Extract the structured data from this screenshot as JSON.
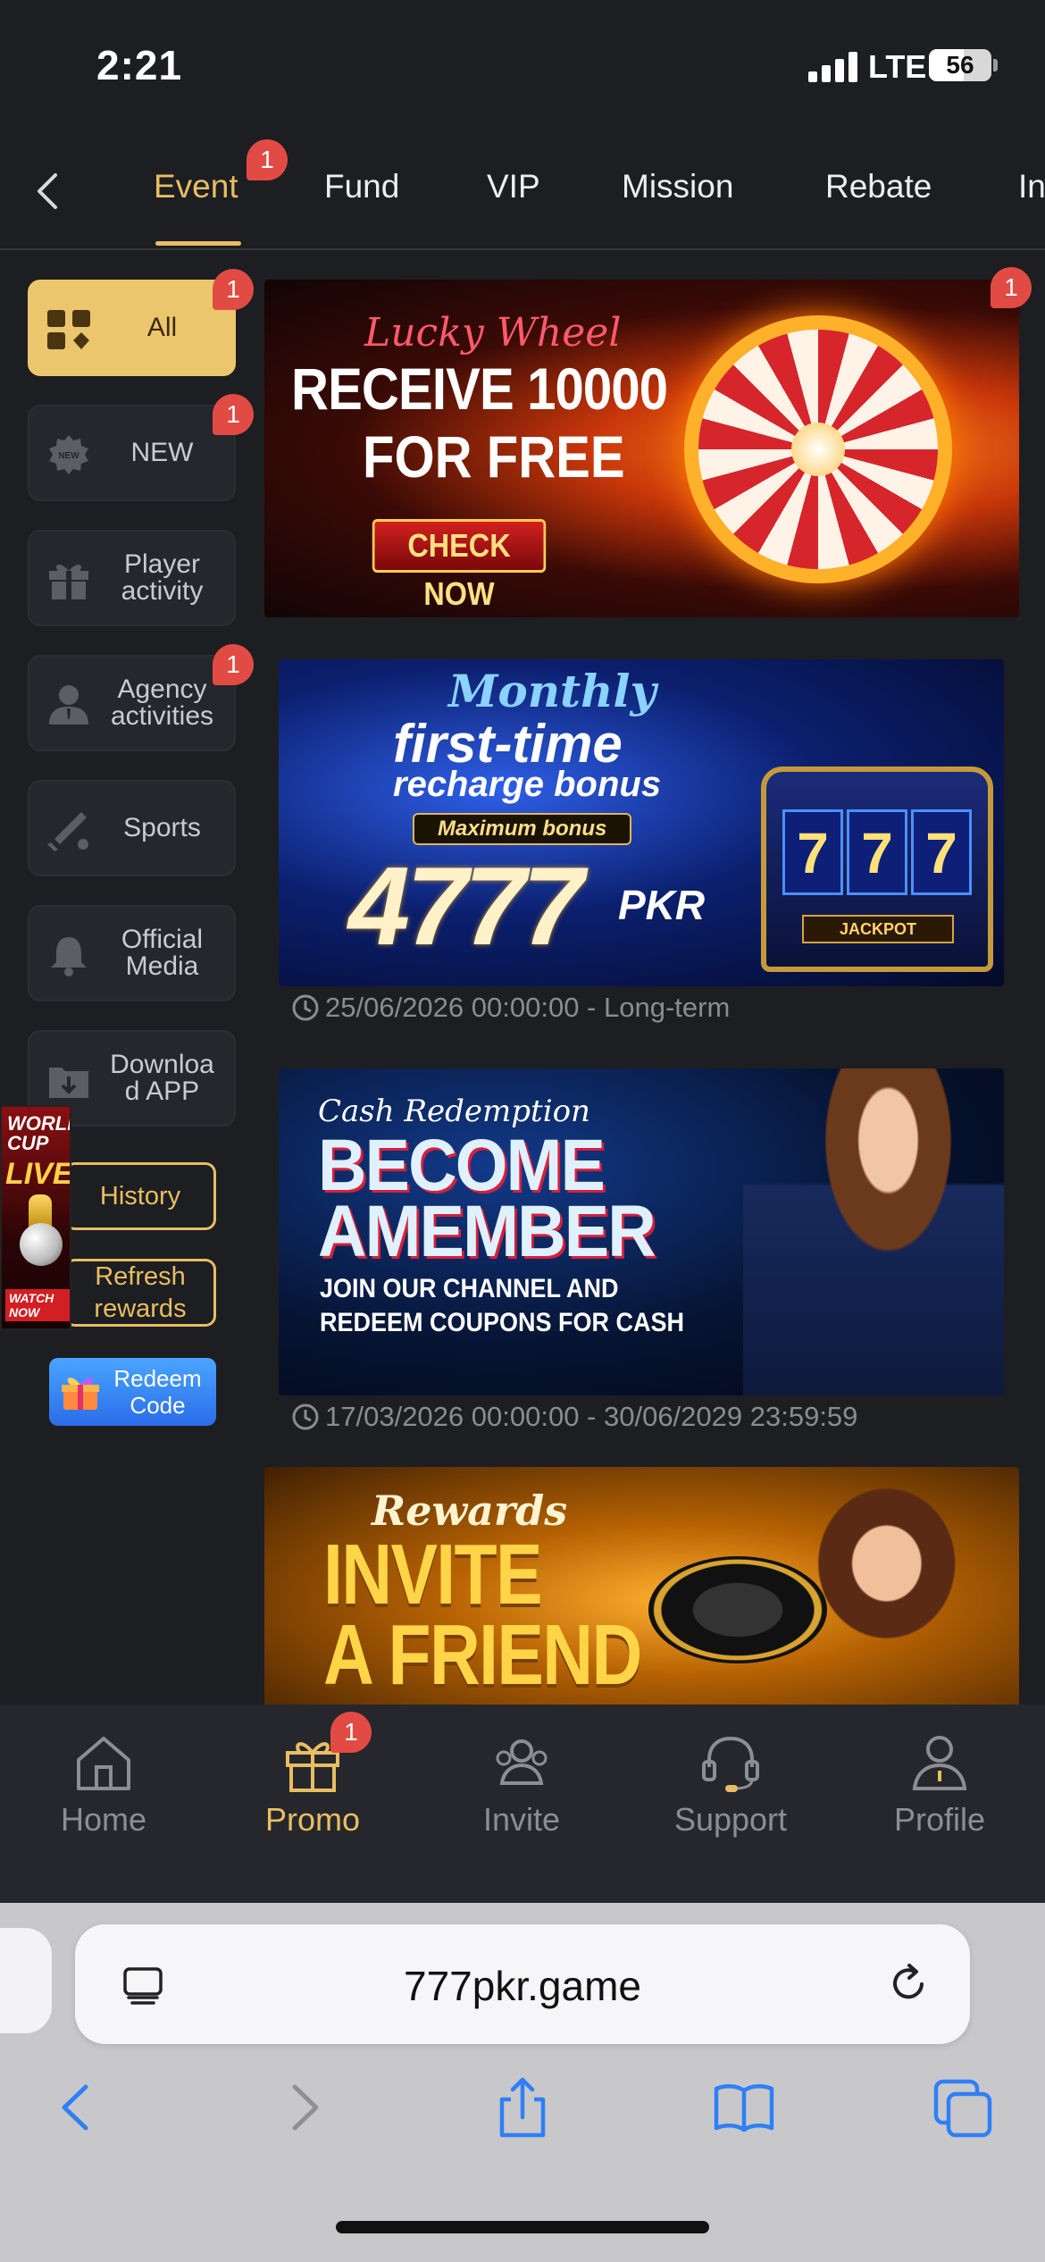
{
  "status_bar": {
    "time": "2:21",
    "network": "LTE",
    "battery": "56"
  },
  "tabs": [
    {
      "label": "Event",
      "active": true,
      "badge": "1"
    },
    {
      "label": "Fund"
    },
    {
      "label": "VIP"
    },
    {
      "label": "Mission"
    },
    {
      "label": "Rebate"
    },
    {
      "label": "In"
    }
  ],
  "sidebar": {
    "items": [
      {
        "label": "All",
        "active": true,
        "badge": "1",
        "icon": "grid-icon"
      },
      {
        "label": "NEW",
        "badge": "1",
        "icon": "new-badge-icon"
      },
      {
        "label": "Player activity",
        "icon": "gift-icon"
      },
      {
        "label": "Agency activities",
        "badge": "1",
        "icon": "agent-icon"
      },
      {
        "label": "Sports",
        "icon": "sports-icon"
      },
      {
        "label": "Official Media",
        "icon": "bell-icon"
      },
      {
        "label": "Download APP",
        "icon": "download-icon"
      }
    ],
    "history": "History",
    "refresh_rewards": "Refresh rewards",
    "redeem_code": "Redeem Code",
    "worldcup_ad": {
      "line1": "WORLD CUP",
      "line2": "LIVE",
      "cta": "WATCH NOW"
    }
  },
  "banners": [
    {
      "badge": "1",
      "script": "Lucky Wheel",
      "line1": "RECEIVE 10000",
      "line2": "FOR FREE",
      "cta": "CHECK NOW"
    },
    {
      "script": "Monthly",
      "line1": "first-time",
      "line2": "recharge bonus",
      "tag": "Maximum bonus",
      "amount": "4777",
      "currency": "PKR",
      "slot_text": "777",
      "jackpot": "JACKPOT",
      "date": "25/06/2026 00:00:00 - Long-term"
    },
    {
      "script": "Cash Redemption",
      "line1": "BECOME",
      "line2": "AMEMBER",
      "sub1": "JOIN OUR CHANNEL AND",
      "sub2": "REDEEM COUPONS FOR CASH",
      "date": "17/03/2026 00:00:00 - 30/06/2029 23:59:59"
    },
    {
      "script": "Rewards",
      "line1": "INVITE",
      "line2": "A FRIEND"
    }
  ],
  "bottom_nav": [
    {
      "label": "Home",
      "icon": "home-icon"
    },
    {
      "label": "Promo",
      "icon": "gift-icon",
      "active": true,
      "badge": "1"
    },
    {
      "label": "Invite",
      "icon": "invite-icon"
    },
    {
      "label": "Support",
      "icon": "headset-icon"
    },
    {
      "label": "Profile",
      "icon": "profile-icon"
    }
  ],
  "browser": {
    "url": "777pkr.game"
  },
  "colors": {
    "accent": "#e9bd62",
    "badge": "#e14b43",
    "background": "#1c1e22",
    "panel": "#25272c"
  }
}
